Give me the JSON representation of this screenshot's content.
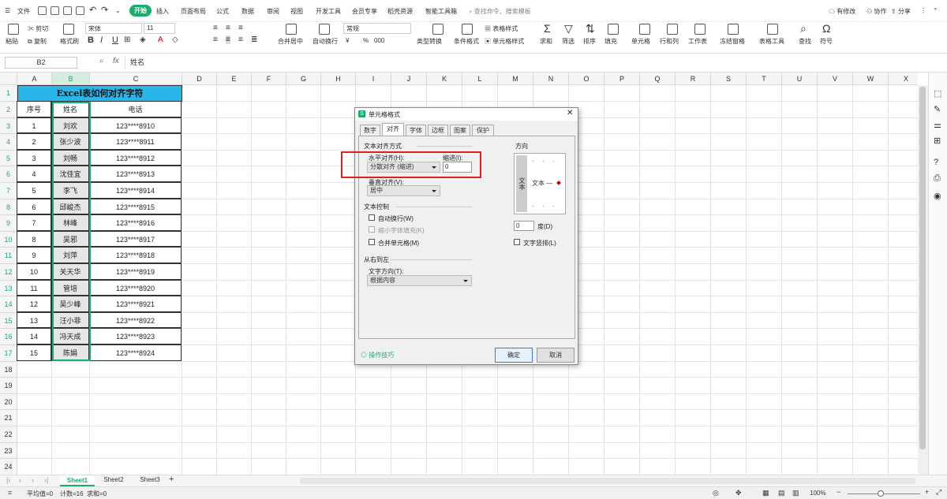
{
  "menubar": {
    "file": "文件",
    "tabs": [
      "开始",
      "插入",
      "页面布局",
      "公式",
      "数据",
      "审阅",
      "视图",
      "开发工具",
      "会员专享",
      "稻壳资源",
      "智能工具箱"
    ],
    "search": "查找命令、搜索模板",
    "right": [
      "有修改",
      "协作",
      "分享"
    ]
  },
  "ribbon": {
    "paste": "粘贴",
    "cut": "剪切",
    "copy": "复制",
    "format_painter": "格式刷",
    "font": "宋体",
    "size": "11",
    "merge": "合并居中",
    "wrap": "自动换行",
    "numfmt": "常规",
    "convert": "类型转换",
    "cond": "条件格式",
    "table_style": "表格样式",
    "cell_style": "单元格样式",
    "sum": "求和",
    "filter": "筛选",
    "sort": "排序",
    "fill": "填充",
    "cell": "单元格",
    "rowcol": "行和列",
    "sheet": "工作表",
    "freeze": "冻结窗格",
    "tabletool": "表格工具",
    "find": "查找",
    "symbol": "符号",
    "pct": "%",
    "num000": "000",
    "bold": "B",
    "italic": "I",
    "underline": "U"
  },
  "formula": {
    "cellref": "B2",
    "fx": "fx",
    "value": "姓名"
  },
  "columns": [
    "A",
    "B",
    "C",
    "D",
    "E",
    "F",
    "G",
    "H",
    "I",
    "J",
    "K",
    "L",
    "M",
    "N",
    "O",
    "P",
    "Q",
    "R",
    "S",
    "T",
    "U",
    "V",
    "W",
    "X"
  ],
  "rows": [
    "1",
    "2",
    "3",
    "4",
    "5",
    "6",
    "7",
    "8",
    "9",
    "10",
    "11",
    "12",
    "13",
    "14",
    "15",
    "16",
    "17",
    "18",
    "19",
    "20",
    "21",
    "22",
    "23",
    "24"
  ],
  "table": {
    "title": "Excel表如何对齐字符",
    "headers": [
      "序号",
      "姓名",
      "电话"
    ],
    "rows": [
      [
        "1",
        "刘欢",
        "123****8910"
      ],
      [
        "2",
        "张少波",
        "123****8911"
      ],
      [
        "3",
        "刘畅",
        "123****8912"
      ],
      [
        "4",
        "沈佳宜",
        "123****8913"
      ],
      [
        "5",
        "李飞",
        "123****8914"
      ],
      [
        "6",
        "邱峻杰",
        "123****8915"
      ],
      [
        "7",
        "林峰",
        "123****8916"
      ],
      [
        "8",
        "吴邪",
        "123****8917"
      ],
      [
        "9",
        "刘萍",
        "123****8918"
      ],
      [
        "10",
        "关天华",
        "123****8919"
      ],
      [
        "11",
        "管培",
        "123****8920"
      ],
      [
        "12",
        "吴少峰",
        "123****8921"
      ],
      [
        "13",
        "汪小菲",
        "123****8922"
      ],
      [
        "14",
        "冯天成",
        "123****8923"
      ],
      [
        "15",
        "陈娟",
        "123****8924"
      ]
    ]
  },
  "sheets": [
    "Sheet1",
    "Sheet2",
    "Sheet3"
  ],
  "status": {
    "avg": "平均值=0",
    "count": "计数=16",
    "sum": "求和=0",
    "zoom": "100%"
  },
  "dialog": {
    "title": "单元格格式",
    "tabs": [
      "数字",
      "对齐",
      "字体",
      "边框",
      "图案",
      "保护"
    ],
    "text_align": "文本对齐方式",
    "horizontal_label": "水平对齐(H):",
    "horizontal_value": "分散对齐 (缩进)",
    "indent_label": "缩进(I):",
    "indent_value": "0",
    "vertical_label": "垂直对齐(V):",
    "vertical_value": "居中",
    "text_control": "文本控制",
    "wrap": "自动换行(W)",
    "shrink": "缩小字体填充(K)",
    "merge": "合并单元格(M)",
    "rtl": "从右到左",
    "direction_label": "文字方向(T):",
    "direction_value": "根据内容",
    "orientation": "方向",
    "vtext": "文本",
    "htext": "文本",
    "degree_value": "0",
    "degree_label": "度(D)",
    "vertical_text": "文字竖排(L)",
    "tips": "操作技巧",
    "ok": "确定",
    "cancel": "取消"
  },
  "colors": {
    "accent": "#1aad6f",
    "title_bg": "#29b6e8",
    "highlight": "#e02020"
  }
}
